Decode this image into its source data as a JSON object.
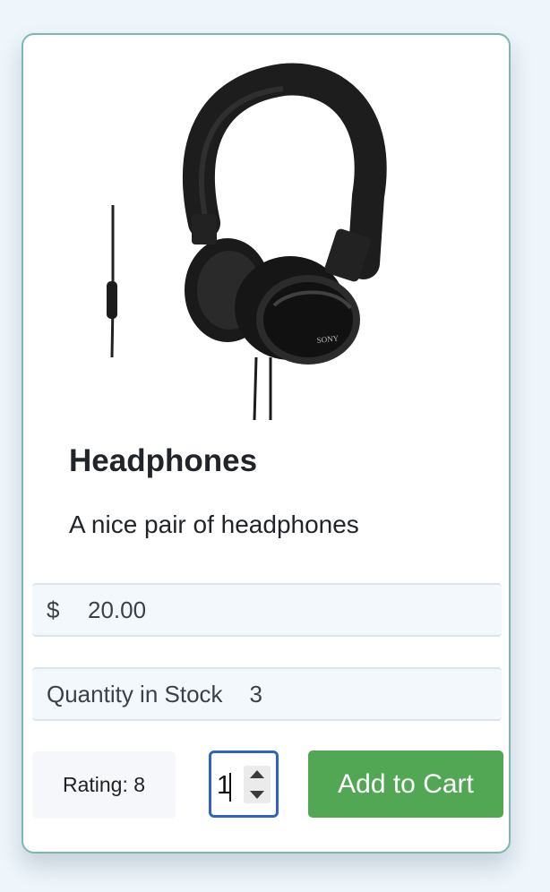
{
  "product": {
    "image_icon": "headphones-image",
    "title": "Headphones",
    "description": "A nice pair of headphones"
  },
  "price": {
    "prefix": "$",
    "value": "20.00"
  },
  "stock": {
    "label": "Quantity in Stock",
    "value": "3"
  },
  "rating": {
    "text": "Rating: 8"
  },
  "quantity_input": {
    "value": "1"
  },
  "actions": {
    "add_to_cart_label": "Add to Cart"
  },
  "colors": {
    "accent_button": "#52a755",
    "focus_border": "#2e62c7",
    "card_border": "#7fb7b0",
    "page_background": "#eef5fb"
  }
}
